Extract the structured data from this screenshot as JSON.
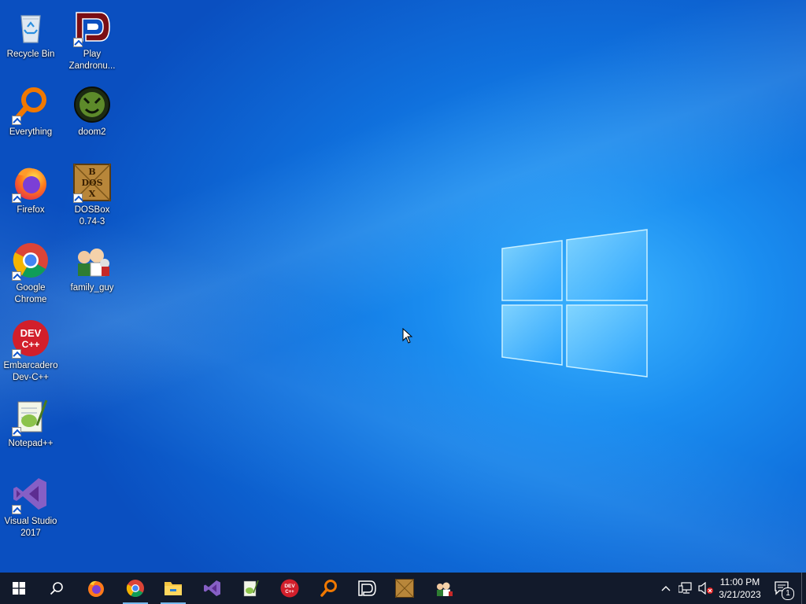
{
  "desktop": {
    "icons": [
      {
        "label": "Recycle Bin",
        "icon": "recycle-bin-icon"
      },
      {
        "label": "Play\nZandronu...",
        "icon": "zandronum-icon"
      },
      {
        "label": "Everything",
        "icon": "everything-search-icon"
      },
      {
        "label": "doom2",
        "icon": "doom2-icon"
      },
      {
        "label": "Firefox",
        "icon": "firefox-icon"
      },
      {
        "label": "DOSBox\n0.74-3",
        "icon": "dosbox-icon"
      },
      {
        "label": "Google\nChrome",
        "icon": "chrome-icon"
      },
      {
        "label": "family_guy",
        "icon": "family-guy-icon"
      },
      {
        "label": "Embarcadero\nDev-C++",
        "icon": "devcpp-icon"
      },
      {
        "label": "Notepad++",
        "icon": "notepadpp-icon"
      },
      {
        "label": "Visual Studio\n2017",
        "icon": "visual-studio-icon"
      }
    ],
    "devcpp_badge": "DEV\nC++",
    "dosbox_letters": "B\nDOS\nX"
  },
  "taskbar": {
    "pinned": [
      "start-icon",
      "search-icon",
      "firefox-icon",
      "chrome-icon",
      "file-explorer-icon",
      "visual-studio-icon",
      "notepadpp-icon",
      "devcpp-icon",
      "everything-search-icon",
      "zandronum-icon",
      "dosbox-icon",
      "family-guy-icon"
    ],
    "clock": {
      "time": "11:00 PM",
      "date": "3/21/2023"
    },
    "notification_count": "1",
    "devcpp_label": "DEV\nC++"
  },
  "colors": {
    "taskbar": "#121a2b",
    "accent": "#76b9ed",
    "desktop": "#0f6fdc"
  }
}
